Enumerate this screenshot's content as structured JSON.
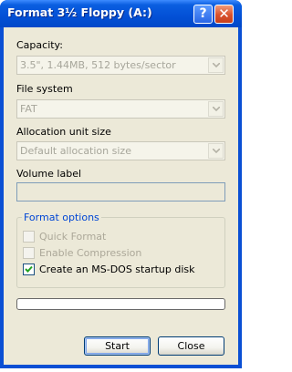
{
  "window": {
    "title": "Format 3½ Floppy (A:)",
    "help_glyph": "?",
    "close_glyph": "✕"
  },
  "capacity": {
    "label": "Capacity:",
    "value": "3.5\",  1.44MB, 512 bytes/sector"
  },
  "file_system": {
    "label": "File system",
    "value": "FAT"
  },
  "allocation": {
    "label": "Allocation unit size",
    "value": "Default allocation size"
  },
  "volume": {
    "label": "Volume label",
    "value": ""
  },
  "format_options": {
    "title": "Format options",
    "options": [
      {
        "label": "Quick Format",
        "checked": false,
        "enabled": false
      },
      {
        "label": "Enable Compression",
        "checked": false,
        "enabled": false
      },
      {
        "label": "Create an MS-DOS startup disk",
        "checked": true,
        "enabled": true
      }
    ]
  },
  "progress": {
    "fraction": 0.0
  },
  "buttons": {
    "start": "Start",
    "close": "Close"
  },
  "colors": {
    "titlebar": "#0350d6",
    "dialog_bg": "#ece9d8",
    "group_title": "#0046d5",
    "disabled_text": "#aca899"
  }
}
